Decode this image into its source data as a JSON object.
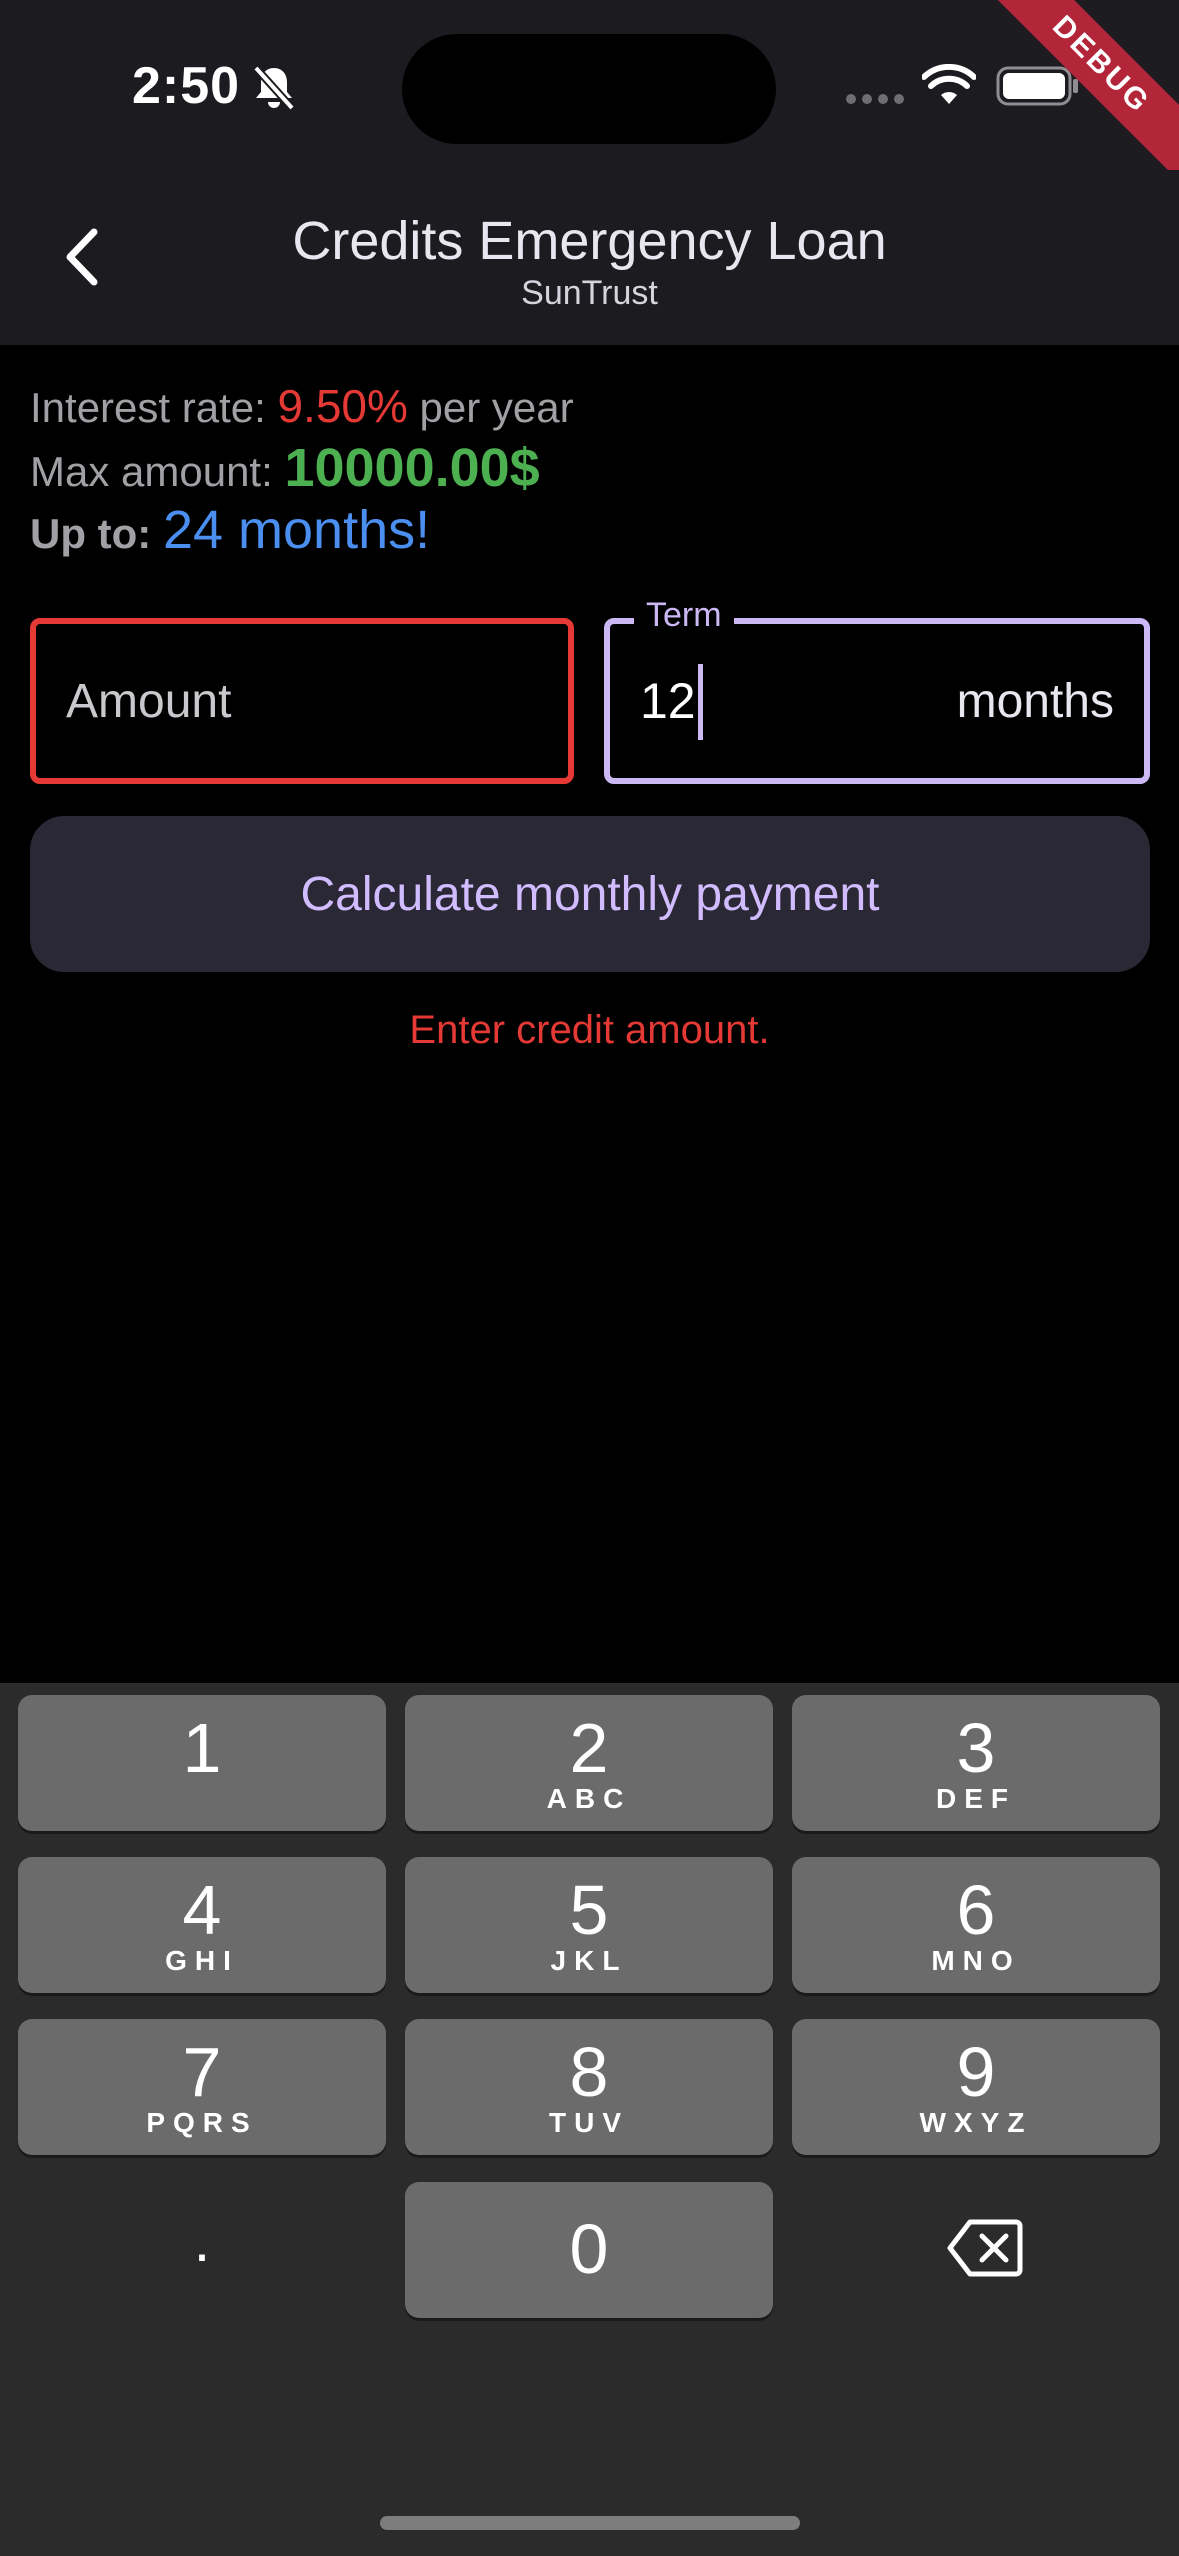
{
  "status_bar": {
    "time": "2:50",
    "debug_label": "DEBUG"
  },
  "app_bar": {
    "title": "Credits Emergency Loan",
    "subtitle": "SunTrust"
  },
  "info": {
    "rate_label": "Interest rate: ",
    "rate_value": "9.50%",
    "rate_suffix": " per year",
    "max_label": "Max amount: ",
    "max_value": "10000.00$",
    "upto_label": "Up to: ",
    "upto_value": "24 months!"
  },
  "form": {
    "amount_placeholder": "Amount",
    "amount_value": "",
    "term_label": "Term",
    "term_value": "12",
    "term_suffix": "months",
    "calculate_label": "Calculate monthly payment",
    "error_text": "Enter credit amount."
  },
  "colors": {
    "error": "#e53935",
    "max_amount": "#4caf50",
    "months": "#4a8ff0",
    "accent": "#cbb8f5"
  },
  "keyboard": {
    "keys": [
      {
        "digit": "1",
        "letters": ""
      },
      {
        "digit": "2",
        "letters": "ABC"
      },
      {
        "digit": "3",
        "letters": "DEF"
      },
      {
        "digit": "4",
        "letters": "GHI"
      },
      {
        "digit": "5",
        "letters": "JKL"
      },
      {
        "digit": "6",
        "letters": "MNO"
      },
      {
        "digit": "7",
        "letters": "PQRS"
      },
      {
        "digit": "8",
        "letters": "TUV"
      },
      {
        "digit": "9",
        "letters": "WXYZ"
      },
      {
        "digit": ".",
        "letters": ""
      },
      {
        "digit": "0",
        "letters": ""
      }
    ],
    "backspace_icon": "backspace-icon"
  }
}
